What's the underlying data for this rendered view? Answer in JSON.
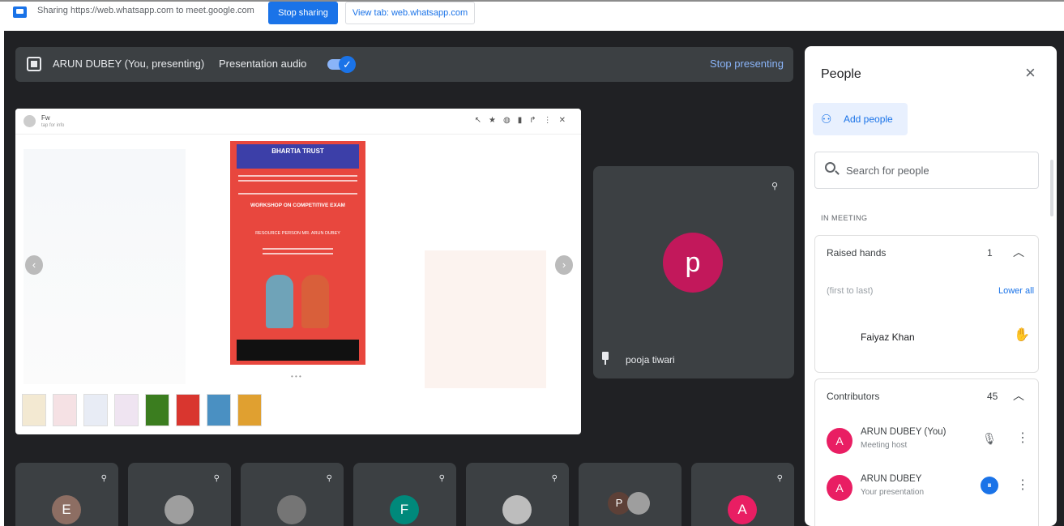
{
  "sharebar": {
    "text": "Sharing https://web.whatsapp.com to meet.google.com",
    "stop_sharing": "Stop sharing",
    "view_tab": "View tab: web.whatsapp.com"
  },
  "presentation_bar": {
    "presenter": "ARUN DUBEY (You, presenting)",
    "audio_label": "Presentation audio",
    "stop_presenting": "Stop presenting"
  },
  "shared_screen": {
    "chat_name": "Fw",
    "chat_sub": "tap for info",
    "toolbar_icons": [
      "pointer-icon",
      "star-icon",
      "rotate-icon",
      "trash-icon",
      "forward-icon",
      "more-icon",
      "close-icon"
    ],
    "poster": {
      "header": "BHARTIA TRUST",
      "title": "WORKSHOP ON COMPETITIVE EXAM",
      "speaker": "RESOURCE PERSON MR. ARUN DUBEY"
    },
    "thumb_colors": [
      "#f3e9d2",
      "#f5e1e4",
      "#e8ecf5",
      "#efe4f1",
      "#3b7d1f",
      "#d9362f",
      "#4a90c2",
      "#e0a030"
    ]
  },
  "featured_tile": {
    "initial": "p",
    "name": "pooja tiwari",
    "avatar_color": "#c2185b"
  },
  "bottom_tiles": [
    {
      "initial": "E",
      "color": "#8d6e63"
    },
    {
      "initial": "",
      "color": "#9e9e9e"
    },
    {
      "initial": "",
      "color": "#757575"
    },
    {
      "initial": "F",
      "color": "#00897b"
    },
    {
      "initial": "",
      "color": "#bdbdbd"
    },
    {
      "initial": "P",
      "color": "#5d4037"
    },
    {
      "initial": "A",
      "color": "#e91e63"
    }
  ],
  "people_panel": {
    "title": "People",
    "add_people": "Add people",
    "search_placeholder": "Search for people",
    "in_meeting": "IN MEETING",
    "raised_hands": {
      "label": "Raised hands",
      "count": "1",
      "order_text": "(first to last)",
      "lower_all": "Lower all",
      "person": "Faiyaz Khan"
    },
    "contributors": {
      "label": "Contributors",
      "count": "45",
      "people": [
        {
          "initial": "A",
          "name": "ARUN DUBEY (You)",
          "sub": "Meeting host"
        },
        {
          "initial": "A",
          "name": "ARUN DUBEY",
          "sub": "Your presentation"
        }
      ]
    }
  }
}
